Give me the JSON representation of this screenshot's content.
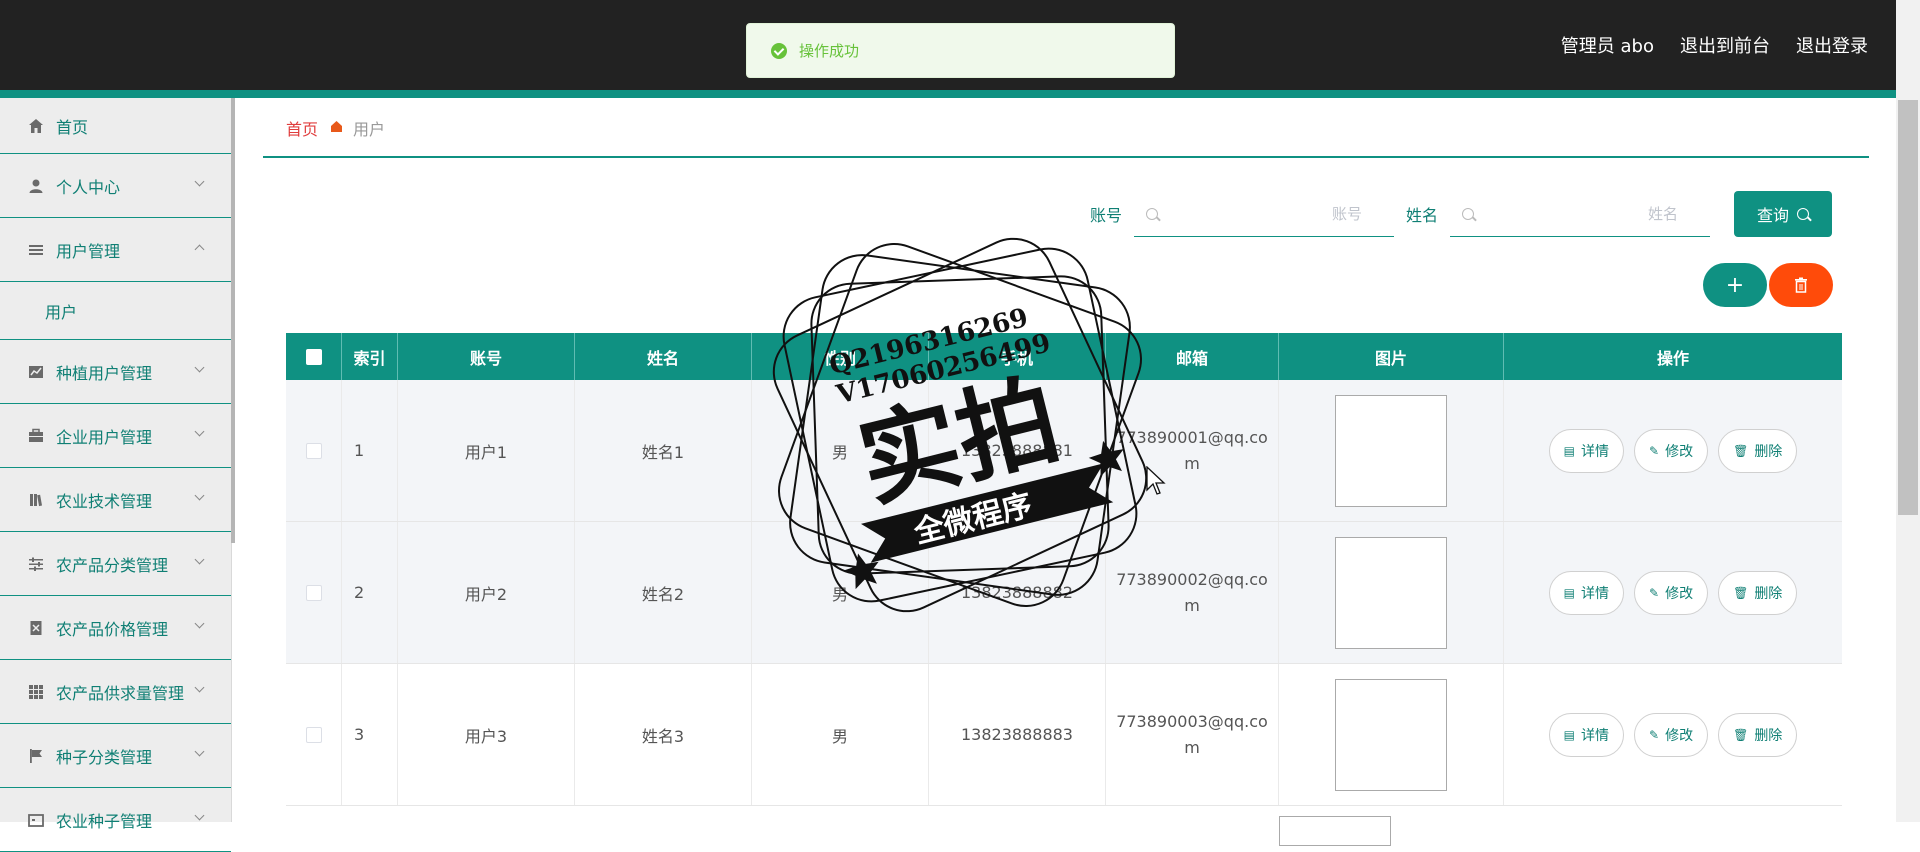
{
  "header": {
    "admin_label": "管理员 abo",
    "to_front_label": "退出到前台",
    "logout_label": "退出登录"
  },
  "toast": {
    "message": "操作成功"
  },
  "sidebar": {
    "items": [
      {
        "label": "首页",
        "icon": "home-icon"
      },
      {
        "label": "个人中心",
        "icon": "user-icon"
      },
      {
        "label": "用户管理",
        "icon": "list-icon",
        "expanded": true,
        "children": [
          "用户"
        ]
      },
      {
        "label": "种植用户管理",
        "icon": "chart-icon"
      },
      {
        "label": "企业用户管理",
        "icon": "briefcase-icon"
      },
      {
        "label": "农业技术管理",
        "icon": "book-icon"
      },
      {
        "label": "农产品分类管理",
        "icon": "sliders-icon"
      },
      {
        "label": "农产品价格管理",
        "icon": "doc-icon"
      },
      {
        "label": "农产品供求量管理",
        "icon": "grid-icon"
      },
      {
        "label": "种子分类管理",
        "icon": "flag-icon"
      },
      {
        "label": "农业种子管理",
        "icon": "box-icon"
      }
    ]
  },
  "breadcrumb": {
    "home": "首页",
    "current": "用户"
  },
  "search": {
    "account_label": "账号",
    "account_placeholder": "账号",
    "name_label": "姓名",
    "name_placeholder": "姓名",
    "query_label": "查询"
  },
  "actions": {
    "add": "+",
    "delete": "🗑"
  },
  "table": {
    "headers": [
      "索引",
      "账号",
      "姓名",
      "性别",
      "手机",
      "邮箱",
      "图片",
      "操作"
    ],
    "rows": [
      {
        "index": "1",
        "account": "用户1",
        "name": "姓名1",
        "gender": "男",
        "phone": "13823888881",
        "email": "773890001@qq.com"
      },
      {
        "index": "2",
        "account": "用户2",
        "name": "姓名2",
        "gender": "男",
        "phone": "13823888882",
        "email": "773890002@qq.com"
      },
      {
        "index": "3",
        "account": "用户3",
        "name": "姓名3",
        "gender": "男",
        "phone": "13823888883",
        "email": "773890003@qq.com"
      }
    ],
    "op_labels": {
      "detail": "详情",
      "edit": "修改",
      "delete": "删除"
    }
  },
  "watermark": {
    "line1": "Q2196316269",
    "line2": "V17060256499",
    "main": "实拍",
    "ribbon": "全微程序"
  },
  "colors": {
    "primary": "#0f9182",
    "danger": "#ff4b0a",
    "header_bg": "#222222",
    "success": "#67c23a"
  }
}
